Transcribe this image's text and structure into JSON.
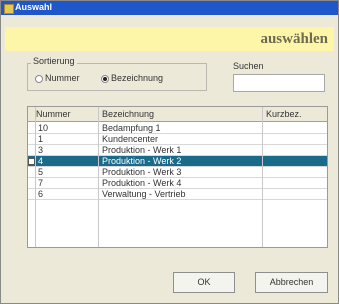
{
  "window": {
    "title": "Auswahl"
  },
  "banner": {
    "text": "auswählen"
  },
  "sort": {
    "label": "Sortierung",
    "options": [
      {
        "label": "Nummer",
        "selected": false
      },
      {
        "label": "Bezeichnung",
        "selected": true
      }
    ]
  },
  "search": {
    "label": "Suchen",
    "value": ""
  },
  "table": {
    "columns": [
      "Nummer",
      "Bezeichnung",
      "Kurzbez."
    ],
    "rows": [
      {
        "nummer": "10",
        "bezeichnung": "Bedampfung 1",
        "kurzbez": ""
      },
      {
        "nummer": "1",
        "bezeichnung": "Kundencenter",
        "kurzbez": ""
      },
      {
        "nummer": "3",
        "bezeichnung": "Produktion - Werk 1",
        "kurzbez": ""
      },
      {
        "nummer": "4",
        "bezeichnung": "Produktion - Werk 2",
        "kurzbez": "",
        "selected": true
      },
      {
        "nummer": "5",
        "bezeichnung": "Produktion - Werk 3",
        "kurzbez": ""
      },
      {
        "nummer": "7",
        "bezeichnung": "Produktion - Werk 4",
        "kurzbez": ""
      },
      {
        "nummer": "6",
        "bezeichnung": "Verwaltung - Vertrieb",
        "kurzbez": ""
      }
    ]
  },
  "buttons": {
    "ok": "OK",
    "cancel": "Abbrechen"
  }
}
